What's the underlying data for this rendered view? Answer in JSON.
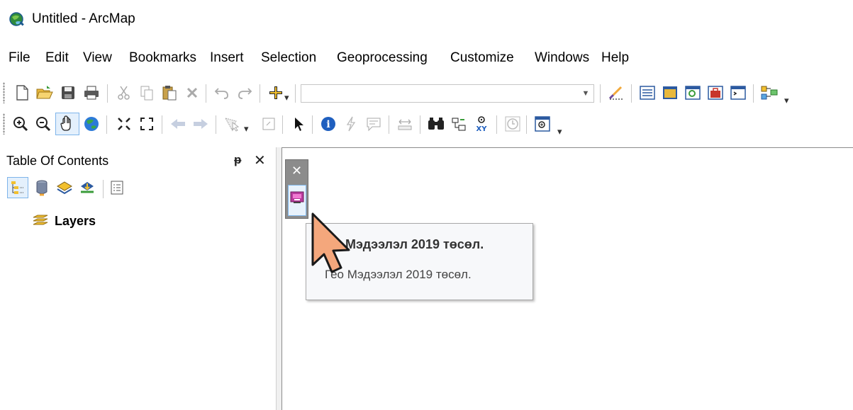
{
  "window": {
    "title": "Untitled - ArcMap",
    "icon": "arcmap-globe-icon"
  },
  "menu": {
    "items": [
      "File",
      "Edit",
      "View",
      "Bookmarks",
      "Insert",
      "Selection",
      "Geoprocessing",
      "Customize",
      "Windows",
      "Help"
    ]
  },
  "standard_toolbar": {
    "scale_value": "",
    "icons": [
      "new-document-icon",
      "open-icon",
      "save-icon",
      "print-icon",
      "cut-icon",
      "copy-icon",
      "paste-icon",
      "delete-icon",
      "undo-icon",
      "redo-icon",
      "add-data-icon",
      "scale-dropdown",
      "editor-toolbar-icon",
      "table-of-contents-icon",
      "catalog-window-icon",
      "search-window-icon",
      "arctoolbox-icon",
      "python-window-icon",
      "model-builder-icon"
    ]
  },
  "tools_toolbar": {
    "icons": [
      "zoom-in-icon",
      "zoom-out-icon",
      "pan-icon",
      "full-extent-icon",
      "fixed-zoom-in-icon",
      "fixed-zoom-out-icon",
      "back-extent-icon",
      "forward-extent-icon",
      "select-features-icon",
      "clear-selection-icon",
      "select-elements-icon",
      "identify-icon",
      "hyperlink-icon",
      "html-popup-icon",
      "measure-icon",
      "find-icon",
      "find-route-icon",
      "go-to-xy-icon",
      "time-slider-icon",
      "magnifier-window-icon"
    ]
  },
  "toc": {
    "title": "Table Of Contents",
    "pin_glyph": "ᵽ",
    "close_glyph": "✕",
    "tools": [
      "list-by-drawing-order-icon",
      "list-by-source-icon",
      "list-by-visibility-icon",
      "list-by-selection-icon",
      "options-icon"
    ],
    "root_layer": "Layers"
  },
  "floating_toolbar": {
    "close_glyph": "✕",
    "button_icon": "mongolian-tool-icon"
  },
  "tooltip": {
    "title": "Мэдээлэл 2019 төсөл.",
    "description": "Гео Мэдээлэл 2019 төсөл."
  },
  "colors": {
    "accent_blue": "#7fb7ec",
    "floating_bar_gray": "#8c8c8c",
    "cursor_fill": "#f4a77c"
  }
}
